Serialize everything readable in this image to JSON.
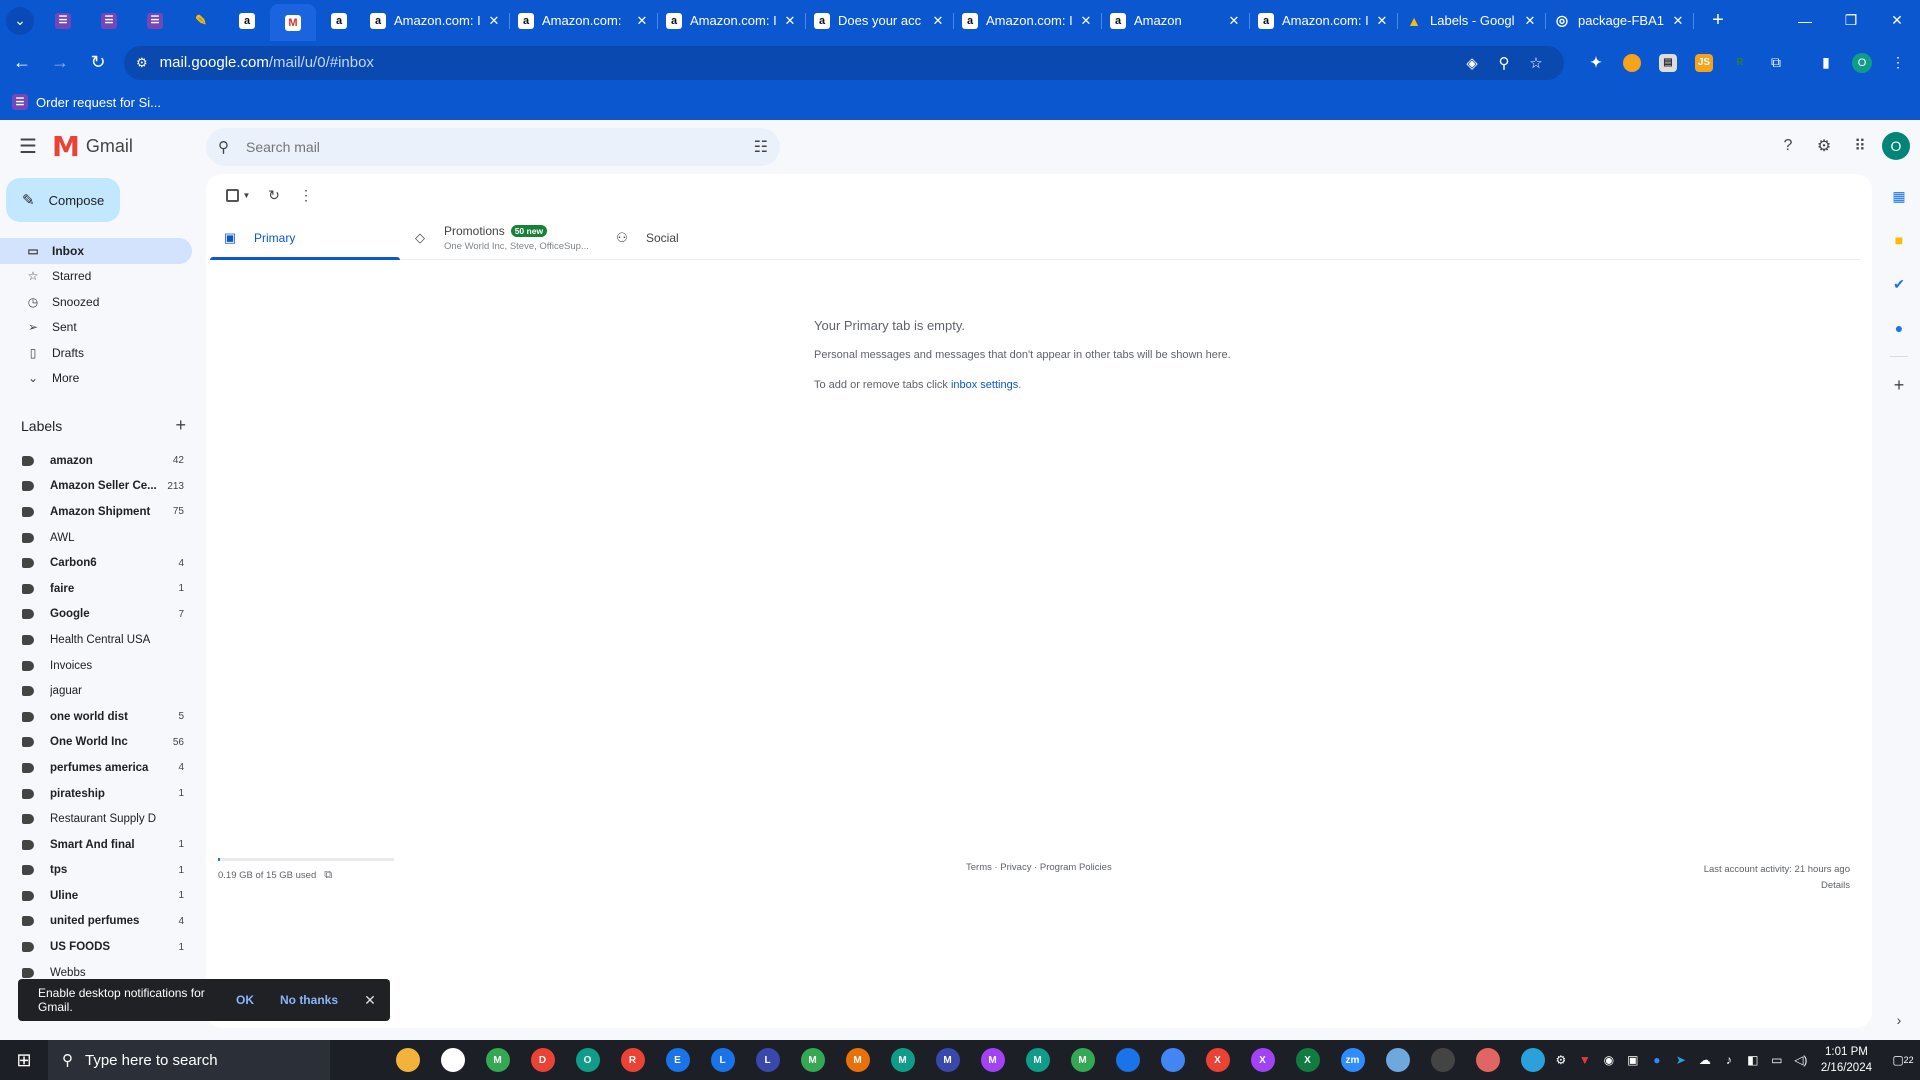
{
  "browser": {
    "pinned_tabs": [
      {
        "icon": "sheets-icon"
      },
      {
        "icon": "sheets-icon"
      },
      {
        "icon": "sheets-icon"
      },
      {
        "icon": "pen-icon"
      },
      {
        "icon": "amazon-icon"
      },
      {
        "icon": "gmail-icon",
        "active": true
      },
      {
        "icon": "amazon-icon"
      }
    ],
    "tabs": [
      {
        "title": "Amazon.com: I",
        "icon": "amazon-icon"
      },
      {
        "title": "Amazon.com: ",
        "icon": "amazon-icon"
      },
      {
        "title": "Amazon.com: I",
        "icon": "amazon-icon"
      },
      {
        "title": "Does your acc",
        "icon": "amazon-icon"
      },
      {
        "title": "Amazon.com: I",
        "icon": "amazon-icon"
      },
      {
        "title": "Amazon",
        "icon": "amazon-icon"
      },
      {
        "title": "Amazon.com: I",
        "icon": "amazon-icon"
      },
      {
        "title": "Labels - Googl",
        "icon": "drive-icon"
      },
      {
        "title": "package-FBA1",
        "icon": "globe-icon"
      }
    ],
    "url_host": "mail.google.com",
    "url_path": "/mail/u/0/#inbox",
    "bookmark": "Order request for Si...",
    "profile_initial": "O"
  },
  "gmail": {
    "app_name": "Gmail",
    "search_placeholder": "Search mail",
    "compose_label": "Compose",
    "avatar_initial": "O",
    "nav": [
      {
        "label": "Inbox",
        "icon": "inbox-icon",
        "active": true
      },
      {
        "label": "Starred",
        "icon": "star-icon"
      },
      {
        "label": "Snoozed",
        "icon": "clock-icon"
      },
      {
        "label": "Sent",
        "icon": "send-icon"
      },
      {
        "label": "Drafts",
        "icon": "draft-icon"
      },
      {
        "label": "More",
        "icon": "chevron-down-icon"
      }
    ],
    "labels_heading": "Labels",
    "labels": [
      {
        "name": "amazon",
        "count": "42",
        "bold": true
      },
      {
        "name": "Amazon Seller Ce...",
        "count": "213",
        "bold": true
      },
      {
        "name": "Amazon Shipment",
        "count": "75",
        "bold": true
      },
      {
        "name": "AWL",
        "count": "",
        "bold": false
      },
      {
        "name": "Carbon6",
        "count": "4",
        "bold": true
      },
      {
        "name": "faire",
        "count": "1",
        "bold": true
      },
      {
        "name": "Google",
        "count": "7",
        "bold": true
      },
      {
        "name": "Health Central USA",
        "count": "",
        "bold": false
      },
      {
        "name": "Invoices",
        "count": "",
        "bold": false
      },
      {
        "name": "jaguar",
        "count": "",
        "bold": false
      },
      {
        "name": "one world dist",
        "count": "5",
        "bold": true
      },
      {
        "name": "One World Inc",
        "count": "56",
        "bold": true
      },
      {
        "name": "perfumes america",
        "count": "4",
        "bold": true
      },
      {
        "name": "pirateship",
        "count": "1",
        "bold": true
      },
      {
        "name": "Restaurant Supply D",
        "count": "",
        "bold": false
      },
      {
        "name": "Smart And final",
        "count": "1",
        "bold": true
      },
      {
        "name": "tps",
        "count": "1",
        "bold": true
      },
      {
        "name": "Uline",
        "count": "1",
        "bold": true
      },
      {
        "name": "united perfumes",
        "count": "4",
        "bold": true
      },
      {
        "name": "US FOODS",
        "count": "1",
        "bold": true
      },
      {
        "name": "Webbs",
        "count": "",
        "bold": false
      }
    ],
    "tabs": {
      "primary": "Primary",
      "promotions": "Promotions",
      "promotions_badge": "50 new",
      "promotions_sub": "One World Inc, Steve, OfficeSup...",
      "social": "Social"
    },
    "empty": {
      "title": "Your Primary tab is empty.",
      "line1": "Personal messages and messages that don't appear in other tabs will be shown here.",
      "line2_prefix": "To add or remove tabs click ",
      "line2_link": "inbox settings",
      "line2_suffix": "."
    },
    "footer": {
      "storage": "0.19 GB of 15 GB used",
      "storage_fraction": 0.013,
      "links": "Terms · Privacy · Program Policies",
      "activity": "Last account activity: 21 hours ago",
      "details": "Details"
    },
    "snackbar": {
      "text": "Enable desktop notifications for Gmail.",
      "ok": "OK",
      "no_thanks": "No thanks"
    }
  },
  "taskbar": {
    "search_placeholder": "Type here to search",
    "time": "1:01 PM",
    "date": "2/16/2024",
    "notification_count": "22",
    "apps": [
      {
        "icon": "cortana-icon",
        "letter": "",
        "color": "#1c1f26"
      },
      {
        "icon": "file-explorer-icon",
        "letter": "",
        "color": "#f2b33d"
      },
      {
        "icon": "slack-icon",
        "letter": "",
        "color": "#fff"
      },
      {
        "icon": "chrome-icon",
        "letter": "M",
        "color": "#34a853"
      },
      {
        "icon": "chrome-icon",
        "letter": "D",
        "color": "#ea4335"
      },
      {
        "icon": "chrome-icon",
        "letter": "O",
        "color": "#0f9d8a"
      },
      {
        "icon": "chrome-icon",
        "letter": "R",
        "color": "#ea4335"
      },
      {
        "icon": "chrome-icon",
        "letter": "E",
        "color": "#1a73e8"
      },
      {
        "icon": "chrome-icon",
        "letter": "L",
        "color": "#1a73e8"
      },
      {
        "icon": "chrome-icon",
        "letter": "L",
        "color": "#3949ab"
      },
      {
        "icon": "chrome-icon",
        "letter": "M",
        "color": "#34a853"
      },
      {
        "icon": "chrome-icon",
        "letter": "M",
        "color": "#e8710a"
      },
      {
        "icon": "chrome-icon",
        "letter": "M",
        "color": "#0f9d8a"
      },
      {
        "icon": "chrome-icon",
        "letter": "M",
        "color": "#3949ab"
      },
      {
        "icon": "chrome-icon",
        "letter": "M",
        "color": "#a142f4"
      },
      {
        "icon": "chrome-icon",
        "letter": "M",
        "color": "#0f9d8a"
      },
      {
        "icon": "chrome-icon",
        "letter": "M",
        "color": "#34a853"
      },
      {
        "icon": "chrome-icon",
        "letter": "",
        "color": "#1a73e8"
      },
      {
        "icon": "chrome-icon",
        "letter": "",
        "color": "#4285f4"
      },
      {
        "icon": "chrome-icon",
        "letter": "X",
        "color": "#ea4335"
      },
      {
        "icon": "chrome-icon",
        "letter": "X",
        "color": "#a142f4"
      },
      {
        "icon": "excel-icon",
        "letter": "X",
        "color": "#107c41"
      },
      {
        "icon": "zoom-icon",
        "letter": "zm",
        "color": "#2d8cff"
      },
      {
        "icon": "notepad-icon",
        "letter": "",
        "color": "#6fa8dc"
      },
      {
        "icon": "calculator-icon",
        "letter": "",
        "color": "#444"
      },
      {
        "icon": "app-icon",
        "letter": "",
        "color": "#e06666"
      },
      {
        "icon": "telegram-icon",
        "letter": "",
        "color": "#2aa1da"
      }
    ]
  }
}
